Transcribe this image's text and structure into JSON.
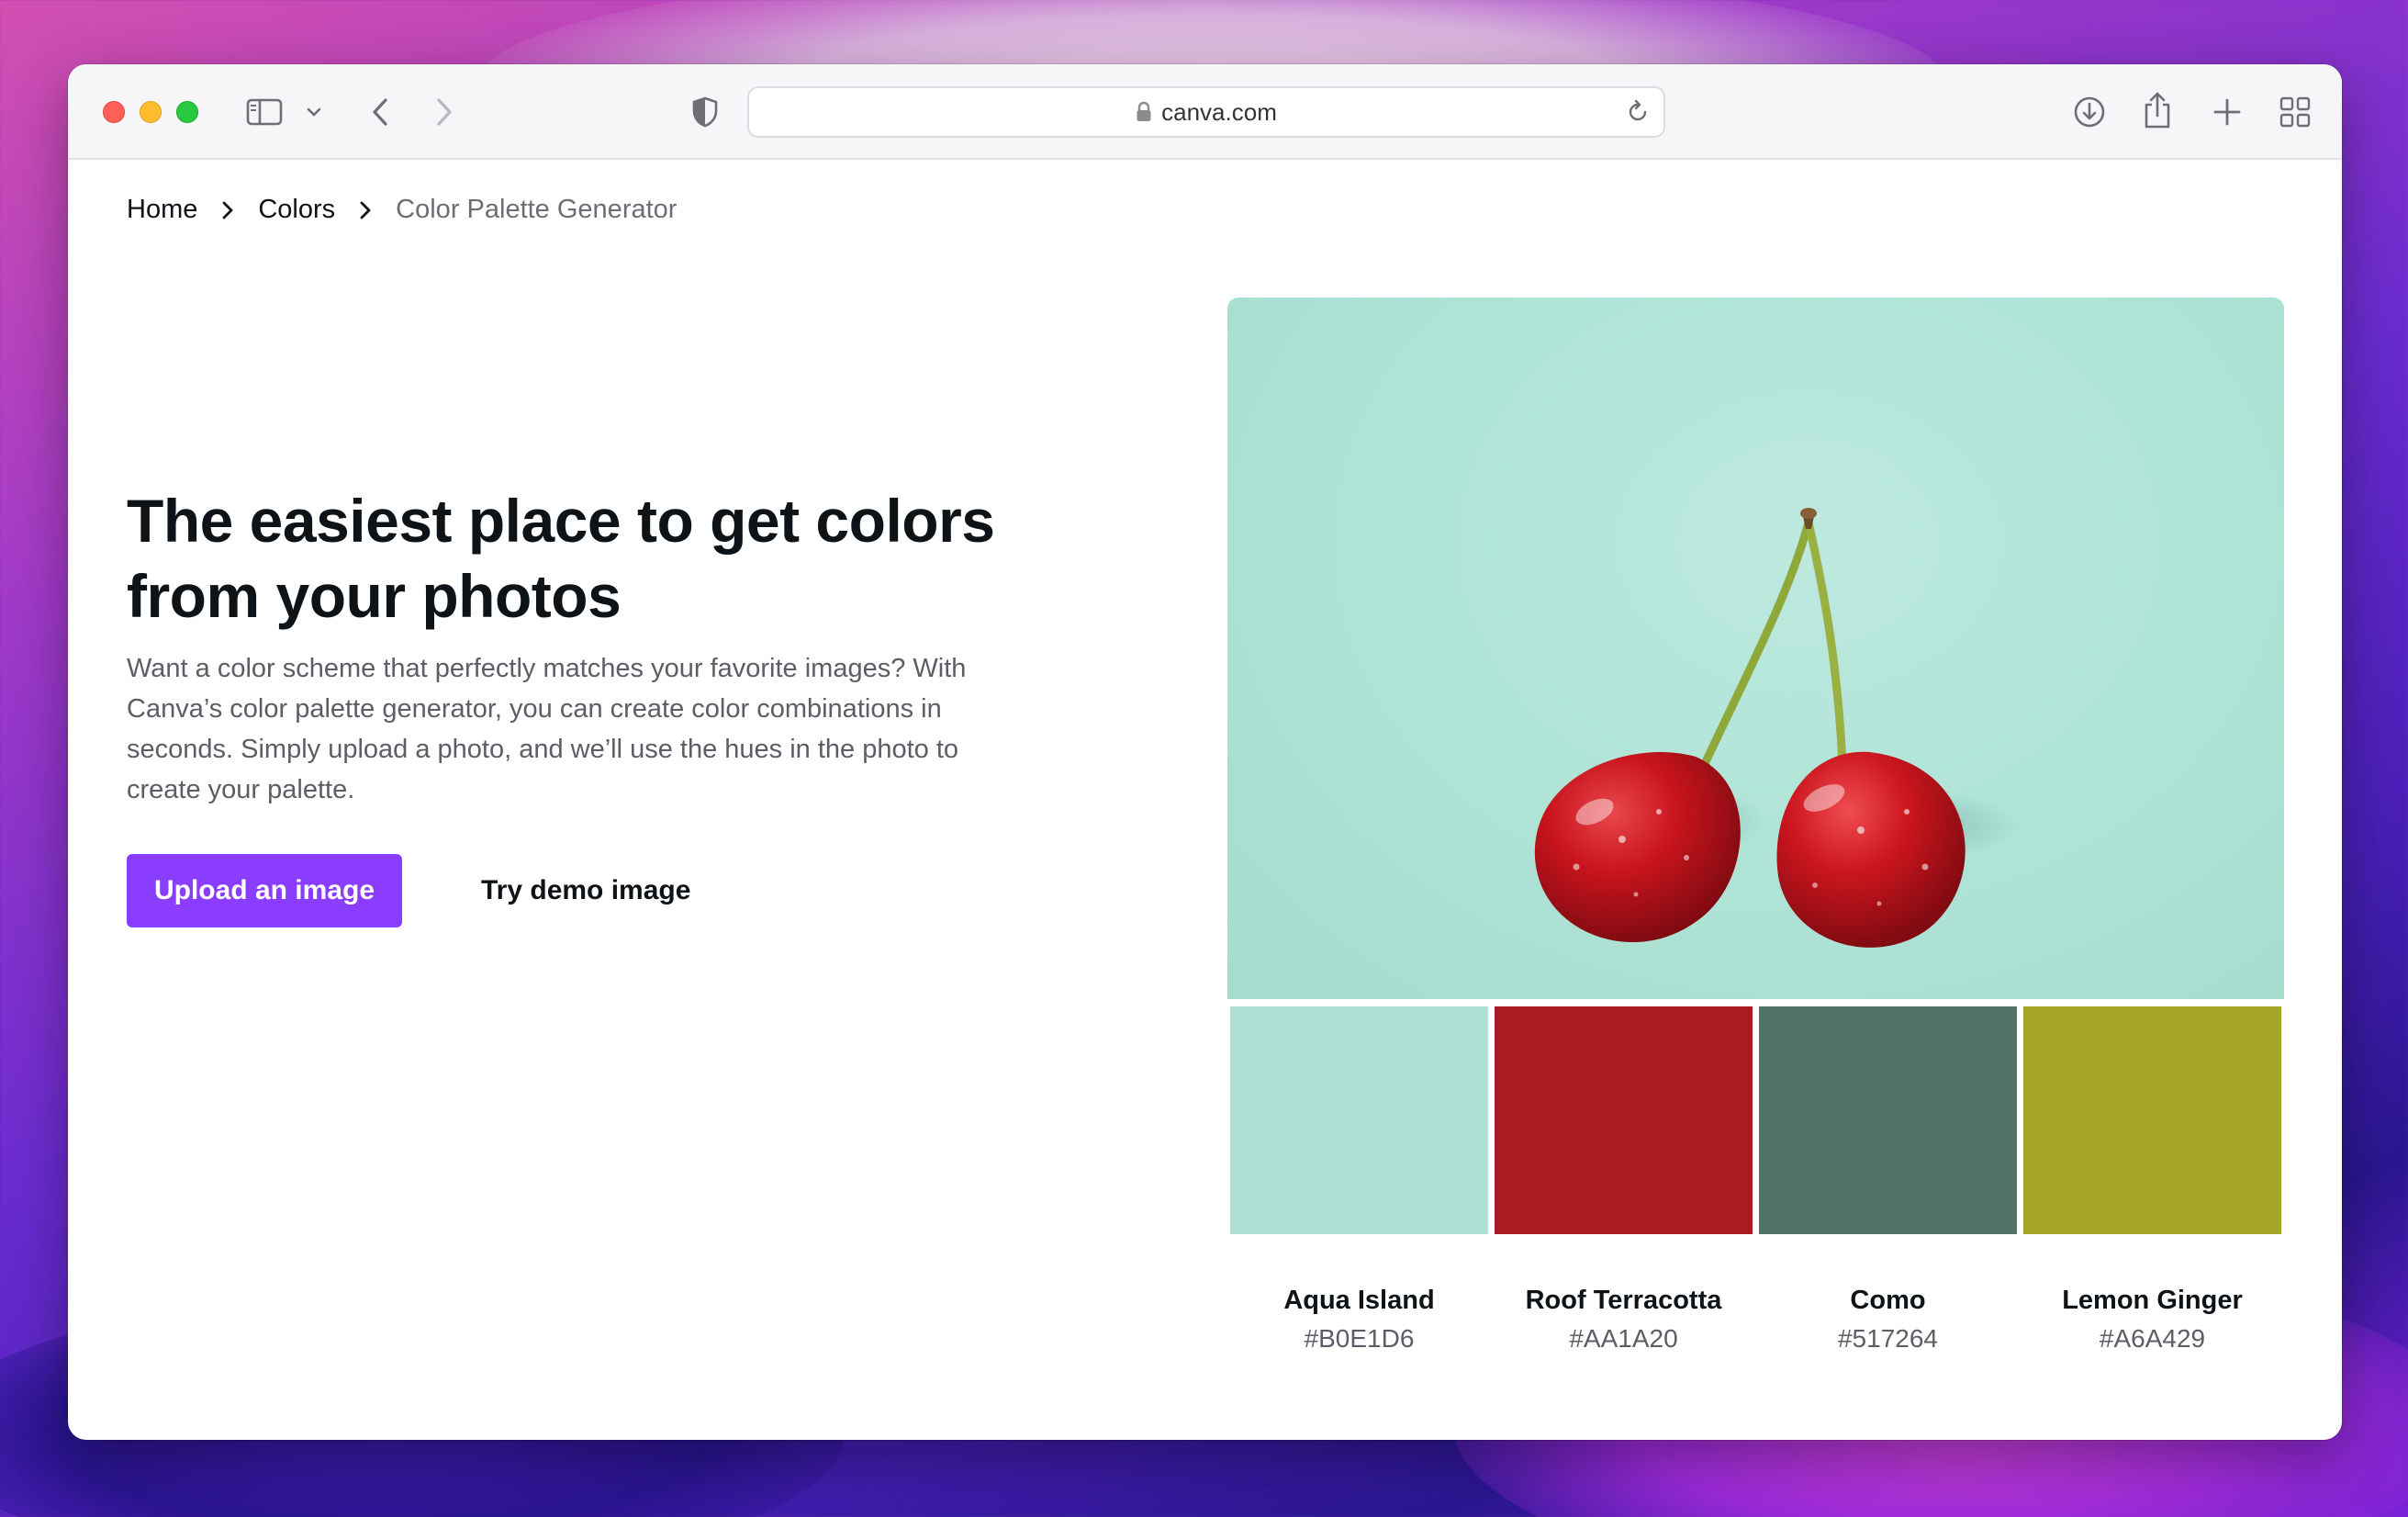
{
  "browser": {
    "url": "canva.com"
  },
  "breadcrumb": {
    "items": [
      "Home",
      "Colors",
      "Color Palette Generator"
    ]
  },
  "hero": {
    "title_line1": "The easiest place to get colors",
    "title_line2": "from your photos",
    "description": "Want a color scheme that perfectly matches your favorite images? With Canva’s color palette generator, you can create color combinations in seconds. Simply upload a photo, and we’ll use the hues in the photo to create your palette.",
    "upload_label": "Upload an image",
    "demo_label": "Try demo image"
  },
  "palette": {
    "colors": [
      {
        "name": "Aqua Island",
        "hex": "#B0E1D6"
      },
      {
        "name": "Roof Terracotta",
        "hex": "#AA1A20"
      },
      {
        "name": "Como",
        "hex": "#517264"
      },
      {
        "name": "Lemon Ginger",
        "hex": "#A6A429"
      }
    ]
  },
  "theme": {
    "accent": "#8b3dff"
  }
}
